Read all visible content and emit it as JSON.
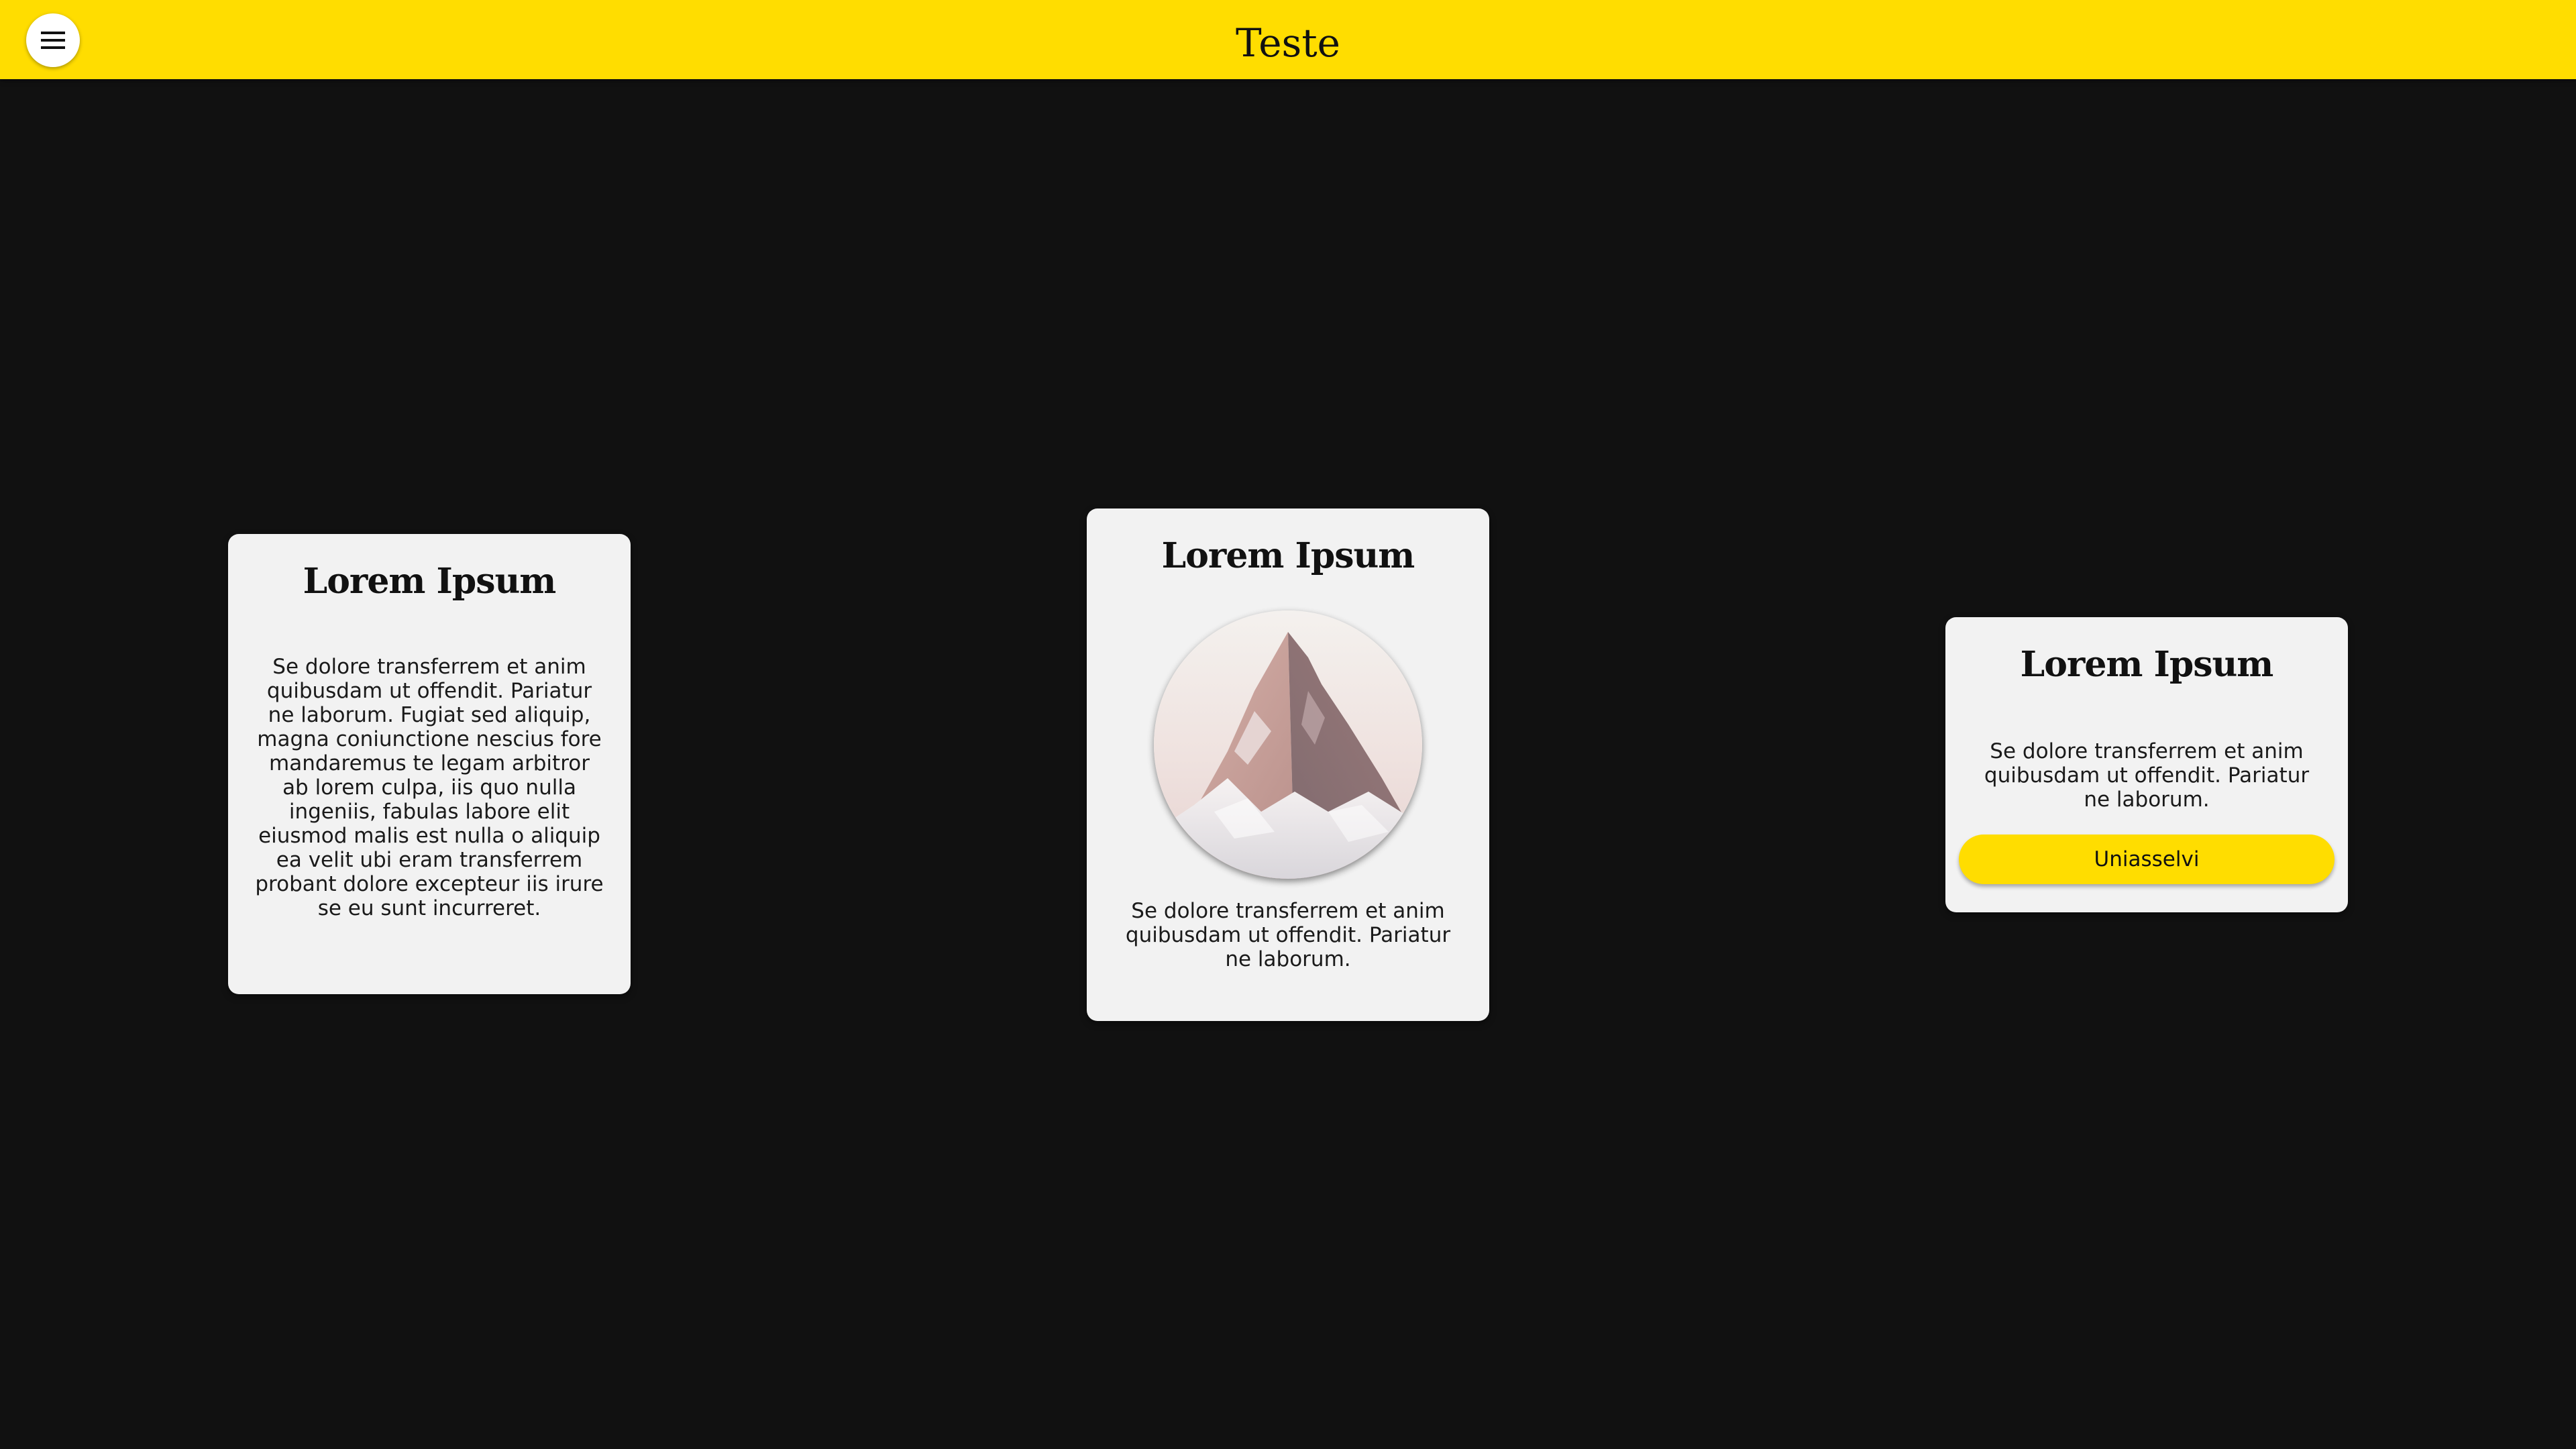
{
  "header": {
    "title": "Teste",
    "menu_icon": "hamburger-menu-icon",
    "background_color": "#ffdd00"
  },
  "page": {
    "background_color": "#111111"
  },
  "cards": [
    {
      "title": "Lorem Ipsum",
      "text": "Se dolore transferrem et anim quibusdam ut offendit. Pariatur ne laborum. Fugiat sed aliquip, magna coniunctione nescius fore mandaremus te legam arbitror ab lorem culpa, iis quo nulla ingeniis, fabulas labore elit eiusmod malis est nulla o aliquip ea velit ubi eram transferrem probant dolore excepteur iis irure se eu sunt incurreret."
    },
    {
      "title": "Lorem Ipsum",
      "image": "mountain-photo",
      "text": "Se dolore transferrem et anim quibusdam ut offendit. Pariatur ne laborum."
    },
    {
      "title": "Lorem Ipsum",
      "text": "Se dolore transferrem et anim quibusdam ut offendit. Pariatur ne laborum.",
      "button_label": "Uniasselvi",
      "button_color": "#ffdd00"
    }
  ]
}
